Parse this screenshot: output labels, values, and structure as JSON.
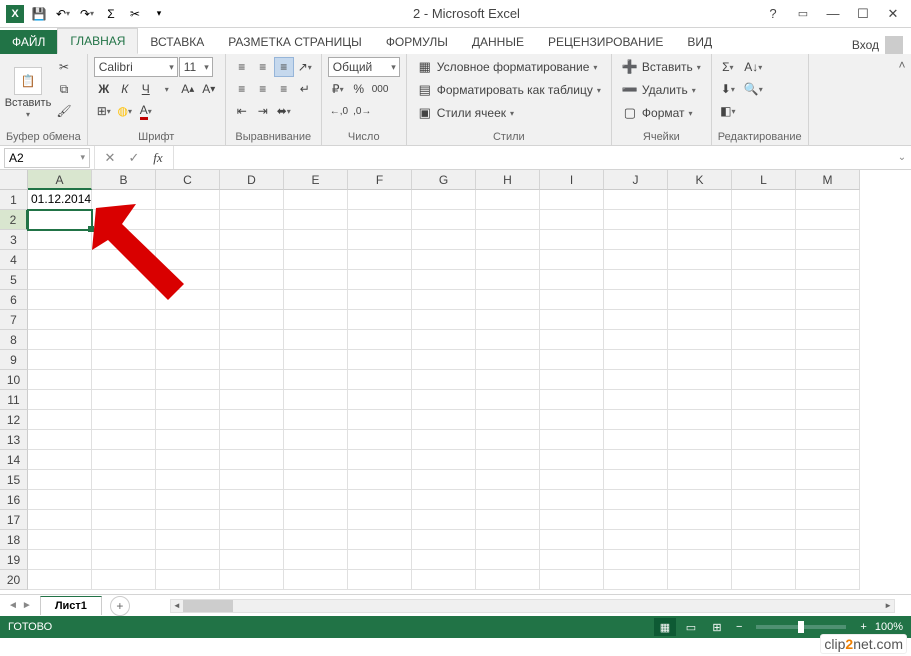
{
  "app": {
    "title": "2 - Microsoft Excel",
    "login_label": "Вход"
  },
  "tabs": {
    "file": "ФАЙЛ",
    "home": "ГЛАВНАЯ",
    "insert": "ВСТАВКА",
    "layout": "РАЗМЕТКА СТРАНИЦЫ",
    "formulas": "ФОРМУЛЫ",
    "data": "ДАННЫЕ",
    "review": "РЕЦЕНЗИРОВАНИЕ",
    "view": "ВИД"
  },
  "ribbon": {
    "clipboard": {
      "label": "Буфер обмена",
      "paste": "Вставить"
    },
    "font": {
      "label": "Шрифт",
      "name": "Calibri",
      "size": "11"
    },
    "alignment": {
      "label": "Выравнивание"
    },
    "number": {
      "label": "Число",
      "format": "Общий"
    },
    "styles": {
      "label": "Стили",
      "cond": "Условное форматирование",
      "table": "Форматировать как таблицу",
      "cell": "Стили ячеек"
    },
    "cells": {
      "label": "Ячейки",
      "insert": "Вставить",
      "delete": "Удалить",
      "format": "Формат"
    },
    "editing": {
      "label": "Редактирование"
    }
  },
  "namebox": "A2",
  "formula": "",
  "columns": [
    "A",
    "B",
    "C",
    "D",
    "E",
    "F",
    "G",
    "H",
    "I",
    "J",
    "K",
    "L",
    "M"
  ],
  "row_count": 20,
  "cells": {
    "A1": "01.12.2014"
  },
  "active_cell": {
    "col": 0,
    "row": 1
  },
  "sheets": {
    "active": "Лист1"
  },
  "status": {
    "ready": "ГОТОВО",
    "zoom": "100%"
  },
  "watermark": {
    "pre": "clip",
    "mid": "2",
    "post": "net.com"
  }
}
